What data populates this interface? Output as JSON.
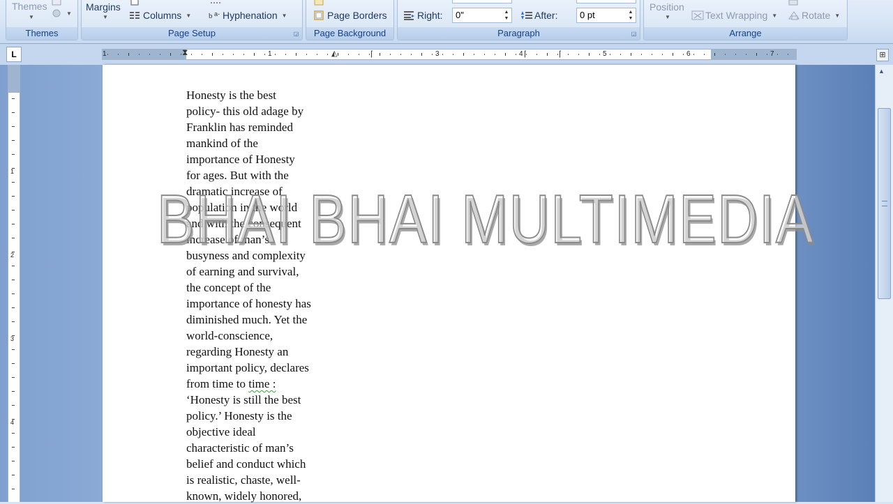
{
  "ribbon": {
    "themes": {
      "button_label": "Themes",
      "group_label": "Themes"
    },
    "page_setup": {
      "margins_label": "Margins",
      "columns_label": "Columns",
      "hyphenation_label": "Hyphenation",
      "group_label": "Page Setup"
    },
    "page_background": {
      "page_borders_label": "Page Borders",
      "group_label": "Page Background"
    },
    "paragraph": {
      "right_label": "Right:",
      "right_value": "0\"",
      "after_label": "After:",
      "after_value": "0 pt",
      "group_label": "Paragraph"
    },
    "arrange": {
      "position_label": "Position",
      "text_wrapping_label": "Text Wrapping",
      "rotate_label": "Rotate",
      "group_label": "Arrange"
    }
  },
  "ruler": {
    "tab_selector": "L",
    "numbers": [
      "1",
      "1",
      "2",
      "3",
      "4",
      "5",
      "6",
      "7"
    ],
    "vertical_numbers": [
      "1",
      "2",
      "3",
      "4"
    ]
  },
  "document": {
    "lines": [
      "Honesty is the best",
      "policy- this old adage by",
      "Franklin has reminded",
      "mankind of the",
      "importance of Honesty",
      "for ages. But with the",
      "dramatic increase of",
      "population in the world",
      "and with the consequent",
      "increase of man’s",
      "busyness and complexity",
      "of earning and survival,",
      "the concept of the",
      "importance of honesty has",
      "diminished much.  Yet the",
      "world-conscience,",
      "regarding Honesty an",
      "important policy, declares",
      "from time to time :",
      "‘Honesty is still the best",
      "policy.’ Honesty is the",
      "objective ideal",
      "characteristic of man’s",
      "belief and conduct which",
      "is realistic, chaste, well-",
      "known, widely honored,"
    ],
    "watermark": "BHAI BHAI MULTIMEDIA"
  },
  "colors": {
    "ribbon_text": "#15428b",
    "page_bg": "#ffffff",
    "workspace": "#a3bde0"
  }
}
